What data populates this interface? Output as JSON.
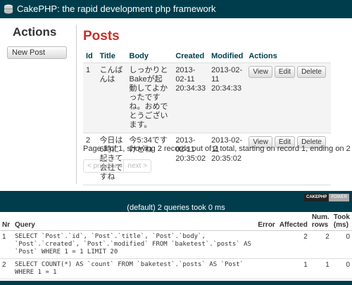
{
  "header": {
    "title": "CakePHP: the rapid development php framework",
    "logo_icon": "cake-icon"
  },
  "sidebar": {
    "heading": "Actions",
    "new_post_label": "New Post"
  },
  "posts": {
    "heading": "Posts",
    "columns": {
      "id": "Id",
      "title": "Title",
      "body": "Body",
      "created": "Created",
      "modified": "Modified",
      "actions": "Actions"
    },
    "rows": [
      {
        "id": "1",
        "title": "こんばんは",
        "body": "しっかりとBakeが起動してよかったですね。おめでとうございます。",
        "created": "2013-02-11 20:34:33",
        "modified": "2013-02-11 20:34:33"
      },
      {
        "id": "2",
        "title": "今日は6時に起きて会社ですね",
        "body": "今5:34ですけどね",
        "created": "2013-02-11 20:35:02",
        "modified": "2013-02-11 20:35:02"
      }
    ],
    "view_label": "View",
    "edit_label": "Edit",
    "delete_label": "Delete",
    "paging_text": "Page 1 of 1, showing 2 records out of 2 total, starting on record 1, ending on 2",
    "prev_label": "< previous",
    "next_label": "next >"
  },
  "debug": {
    "powered_a": "CAKEPHP",
    "powered_b": "POWER",
    "summary": "(default) 2 queries took 0 ms",
    "columns": {
      "nr": "Nr",
      "query": "Query",
      "error": "Error",
      "affected": "Affected",
      "numrows": "Num. rows",
      "took": "Took (ms)"
    },
    "queries": [
      {
        "nr": "1",
        "query": "SELECT `Post`.`id`, `Post`.`title`, `Post`.`body`, `Post`.`created`, `Post`.`modified` FROM `baketest`.`posts` AS `Post` WHERE 1 = 1 LIMIT 20",
        "error": "",
        "affected": "2",
        "numrows": "2",
        "took": "0"
      },
      {
        "nr": "2",
        "query": "SELECT COUNT(*) AS `count` FROM `baketest`.`posts` AS `Post` WHERE 1 = 1",
        "error": "",
        "affected": "1",
        "numrows": "1",
        "took": "0"
      }
    ]
  },
  "colors": {
    "header_bg": "#003d4c",
    "posts_heading": "#c6312b",
    "th_color": "#003d4c"
  }
}
